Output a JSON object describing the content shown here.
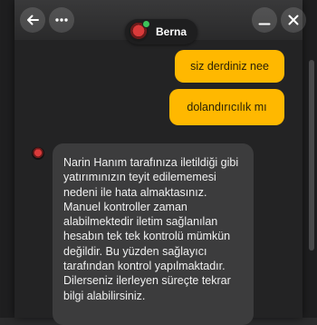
{
  "header": {
    "back_icon": "arrow-left-icon",
    "more_icon": "three-dots-icon",
    "minimize_icon": "minus-icon",
    "close_icon": "close-icon"
  },
  "contact": {
    "name": "Berna",
    "status": "online",
    "status_color": "#3ec35a"
  },
  "messages": {
    "outgoing": [
      {
        "text": "siz derdiniz nee"
      },
      {
        "text": "dolandırıcılık mı"
      }
    ],
    "incoming": [
      {
        "text": "Narin Hanım tarafınıza iletildiği gibi yatırımınızın teyit edilememesi nedeni ile hata almaktasınız. Manuel kontroller zaman alabilmektedir iletim sağlanılan hesabın tek tek kontrolü mümkün değildir. Bu yüzden sağlayıcı tarafından kontrol yapılmaktadır. Dilerseniz ilerleyen süreçte tekrar bilgi alabilirsiniz."
      }
    ]
  },
  "colors": {
    "outgoing_bubble": "#ffb800",
    "incoming_bubble": "#3c3c3d",
    "panel_background": "#232324"
  }
}
